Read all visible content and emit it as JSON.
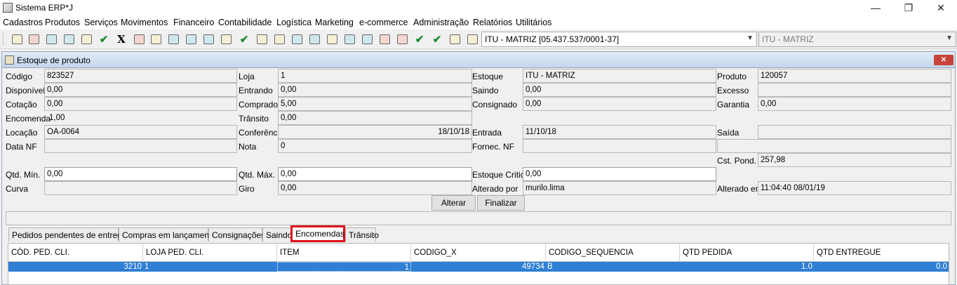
{
  "window": {
    "title": "Sistema ERP*J",
    "minimize": "—",
    "restore": "❐",
    "close": "✕"
  },
  "menu": [
    "Cadastros",
    "Produtos",
    "Serviços",
    "Movimentos",
    "Financeiro",
    "Contabilidade",
    "Logística",
    "Marketing",
    "e-commerce",
    "Administração",
    "Relatórios",
    "Utilitários"
  ],
  "toolbar": {
    "company_combo": "ITU - MATRIZ [05.437.537/0001-37]",
    "branch_combo": "ITU - MATRIZ",
    "icons": [
      "help-icon",
      "document-help-icon",
      "search-doc-icon",
      "search-user-icon",
      "calculator-icon",
      "check-icon",
      "excel-icon",
      "palette-icon",
      "envelope-icon",
      "chart-icon",
      "cart-icon",
      "cart-search-icon",
      "ruler-icon",
      "check-icon",
      "note-icon",
      "pencil-icon",
      "card-icon",
      "card-icon",
      "barcode-icon",
      "card-icon",
      "truck-icon",
      "box-icon",
      "box-icon",
      "check-icon",
      "check-icon",
      "bottle-icon",
      "search-icon"
    ]
  },
  "panel": {
    "title": "Estoque de produto",
    "close": "✕"
  },
  "fields": {
    "codigo": {
      "label": "Código",
      "value": "823527"
    },
    "loja": {
      "label": "Loja",
      "value": "1"
    },
    "estoque": {
      "label": "Estoque",
      "value": "ITU - MATRIZ"
    },
    "produto": {
      "label": "Produto",
      "value": "120057"
    },
    "disponivel": {
      "label": "Disponível",
      "value": "0,00"
    },
    "entrando": {
      "label": "Entrando",
      "value": "0,00"
    },
    "saindo": {
      "label": "Saindo",
      "value": "0,00"
    },
    "excesso": {
      "label": "Excesso",
      "value": ""
    },
    "cotacao": {
      "label": "Cotação",
      "value": "0,00"
    },
    "comprado": {
      "label": "Comprado",
      "value": "5,00"
    },
    "consignado": {
      "label": "Consignado",
      "value": "0,00"
    },
    "garantia": {
      "label": "Garantia",
      "value": "0,00"
    },
    "encomenda": {
      "label": "Encomenda",
      "value": "1,00"
    },
    "transito": {
      "label": "Trânsito",
      "value": "0,00"
    },
    "locacao": {
      "label": "Locação",
      "value": "OA-0064"
    },
    "conferencia": {
      "label": "Conferência",
      "value": "18/10/18"
    },
    "entrada": {
      "label": "Entrada",
      "value": "11/10/18"
    },
    "saida": {
      "label": "Saída",
      "value": ""
    },
    "data_nf": {
      "label": "Data NF",
      "value": ""
    },
    "nota": {
      "label": "Nota",
      "value": "0"
    },
    "fornec_nf": {
      "label": "Fornec. NF",
      "value": ""
    },
    "cst_pond": {
      "label": "Cst. Pond.",
      "value": "257,98"
    },
    "qtd_min": {
      "label": "Qtd. Mín.",
      "value": "0,00"
    },
    "qtd_max": {
      "label": "Qtd. Máx.",
      "value": "0,00"
    },
    "estoque_critico": {
      "label": "Estoque Critico",
      "value": "0,00"
    },
    "curva": {
      "label": "Curva",
      "value": ""
    },
    "giro": {
      "label": "Giro",
      "value": "0,00"
    },
    "alterado_por": {
      "label": "Alterado por",
      "value": "murilo.lima"
    },
    "alterado_em": {
      "label": "Alterado em",
      "value": "11:04:40 08/01/19"
    }
  },
  "buttons": {
    "alterar": "Alterar",
    "finalizar": "Finalizar"
  },
  "tabs": [
    "Pedidos pendentes de entrega",
    "Compras em lançamento",
    "Consignações",
    "Saindo",
    "Encomendas",
    "Trânsito"
  ],
  "active_tab": "Encomendas",
  "table": {
    "columns": [
      "CÓD. PED. CLI.",
      "LOJA PED. CLI.",
      "ITEM",
      "CODIGO_X",
      "CODIGO_SEQUENCIA",
      "QTD PEDIDA",
      "QTD ENTREGUE"
    ],
    "rows": [
      [
        "3210",
        "1",
        "1",
        "49734",
        "B",
        "1.0",
        "0.0"
      ]
    ]
  },
  "colors": {
    "selection": "#2f7fd4",
    "highlight_border": "#e0121c",
    "close_button": "#c8443a"
  }
}
